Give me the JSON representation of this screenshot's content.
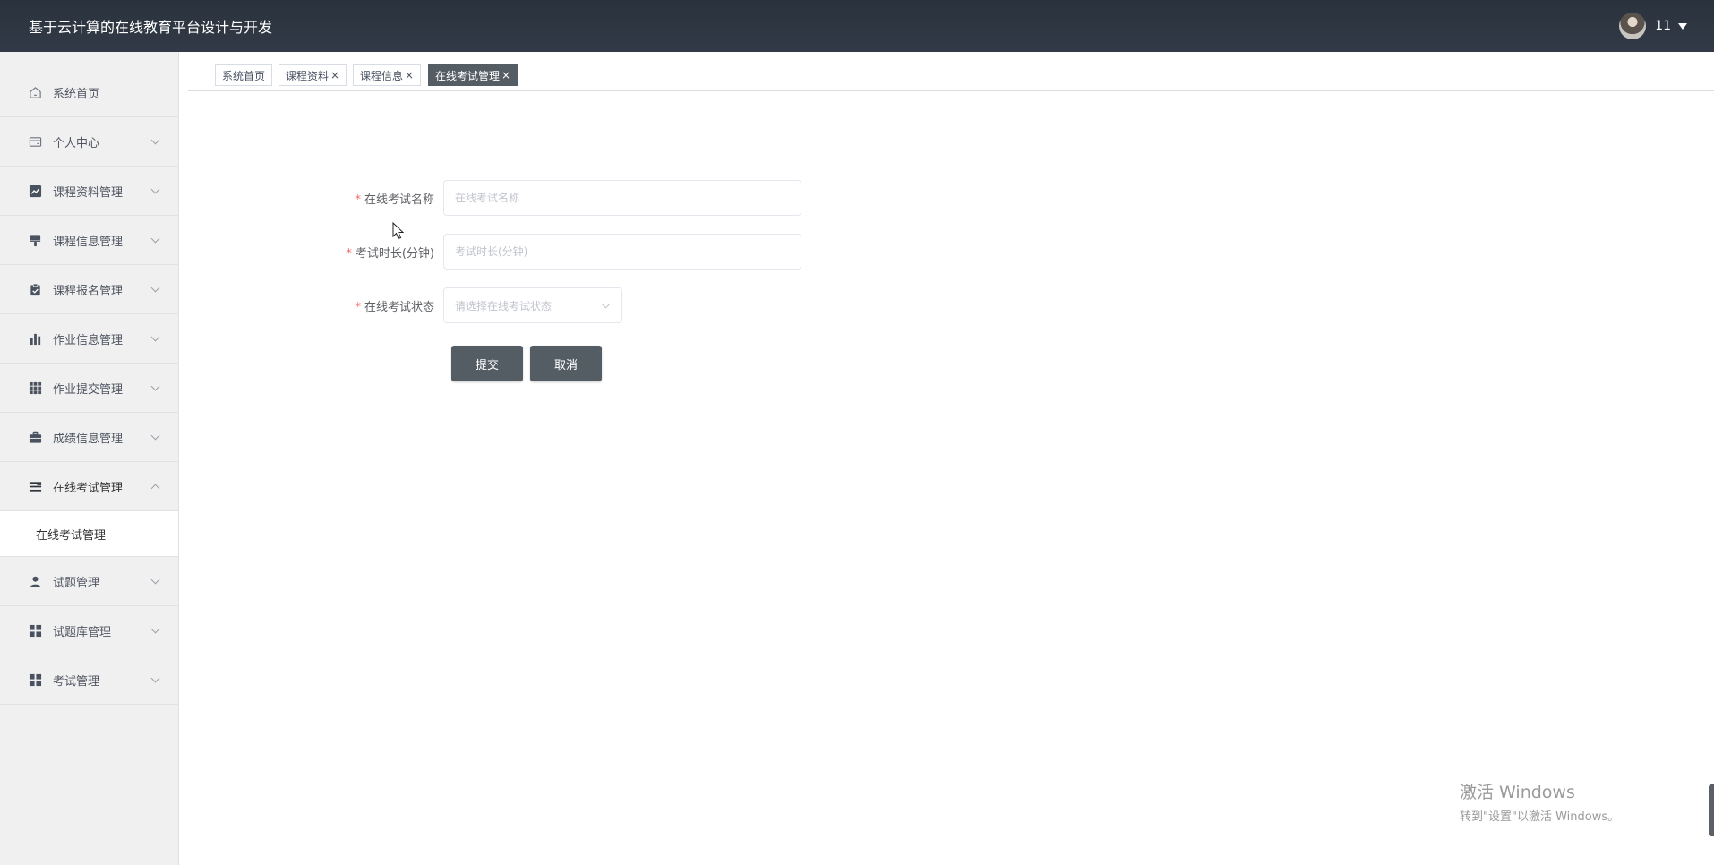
{
  "header": {
    "app_title": "基于云计算的在线教育平台设计与开发",
    "username": "11"
  },
  "sidebar": {
    "items": [
      {
        "label": "系统首页",
        "icon": "home-icon",
        "expandable": false
      },
      {
        "label": "个人中心",
        "icon": "wallet-icon",
        "expandable": true
      },
      {
        "label": "课程资料管理",
        "icon": "chart-line-icon",
        "expandable": true
      },
      {
        "label": "课程信息管理",
        "icon": "brush-icon",
        "expandable": true
      },
      {
        "label": "课程报名管理",
        "icon": "clipboard-icon",
        "expandable": true
      },
      {
        "label": "作业信息管理",
        "icon": "bar-chart-icon",
        "expandable": true
      },
      {
        "label": "作业提交管理",
        "icon": "grid-icon",
        "expandable": true
      },
      {
        "label": "成绩信息管理",
        "icon": "briefcase-icon",
        "expandable": true
      },
      {
        "label": "在线考试管理",
        "icon": "list-icon",
        "expandable": true,
        "expanded": true
      },
      {
        "label": "试题管理",
        "icon": "user-icon",
        "expandable": true
      },
      {
        "label": "试题库管理",
        "icon": "apps-icon",
        "expandable": true
      },
      {
        "label": "考试管理",
        "icon": "apps-icon",
        "expandable": true
      }
    ],
    "submenu": {
      "label": "在线考试管理"
    }
  },
  "tabs": [
    {
      "label": "系统首页",
      "closable": false
    },
    {
      "label": "课程资料",
      "closable": true
    },
    {
      "label": "课程信息",
      "closable": true
    },
    {
      "label": "在线考试管理",
      "closable": true,
      "active": true
    }
  ],
  "form": {
    "exam_name": {
      "label": "在线考试名称",
      "placeholder": "在线考试名称",
      "value": ""
    },
    "duration": {
      "label": "考试时长(分钟)",
      "placeholder": "考试时长(分钟)",
      "value": ""
    },
    "status": {
      "label": "在线考试状态",
      "placeholder": "请选择在线考试状态"
    },
    "submit_label": "提交",
    "cancel_label": "取消"
  },
  "watermark": {
    "line1": "激活 Windows",
    "line2": "转到\"设置\"以激活 Windows。"
  },
  "colors": {
    "header_bg": "#2d3540",
    "sidebar_bg": "#f0f0f0",
    "accent": "#545c64",
    "required": "#f56c6c"
  }
}
